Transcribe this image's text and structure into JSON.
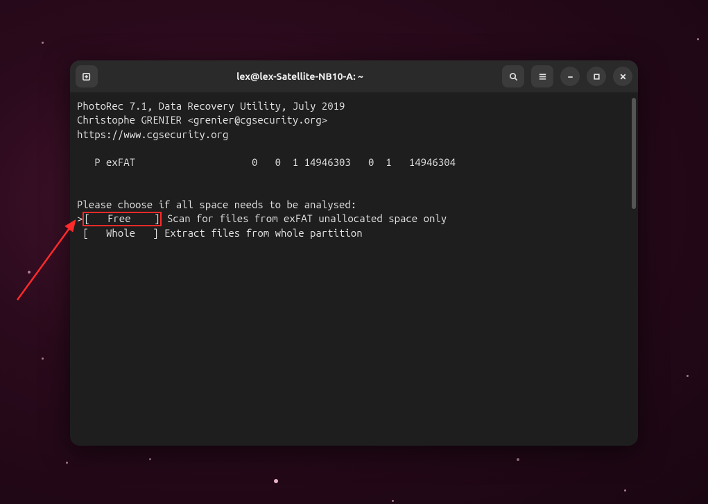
{
  "titlebar": {
    "title": "lex@lex-Satellite-NB10-A: ~"
  },
  "terminal": {
    "header_line1": "PhotoRec 7.1, Data Recovery Utility, July 2019",
    "header_line2": "Christophe GRENIER <grenier@cgsecurity.org>",
    "header_line3": "https://www.cgsecurity.org",
    "partition_line": "   P exFAT                    0   0  1 14946303   0  1   14946304",
    "prompt_line": "Please choose if all space needs to be analysed:",
    "menu_items": [
      {
        "selector": ">",
        "label": "[   Free    ]",
        "description": " Scan for files from exFAT unallocated space only",
        "selected": true
      },
      {
        "selector": " ",
        "label": "[   Whole   ]",
        "description": " Extract files from whole partition",
        "selected": false
      }
    ]
  },
  "colors": {
    "accent_highlight": "#ff2a2a",
    "terminal_bg": "#1e1e1e",
    "terminal_fg": "#e4e4e4",
    "titlebar_bg": "#2a2a2a"
  }
}
